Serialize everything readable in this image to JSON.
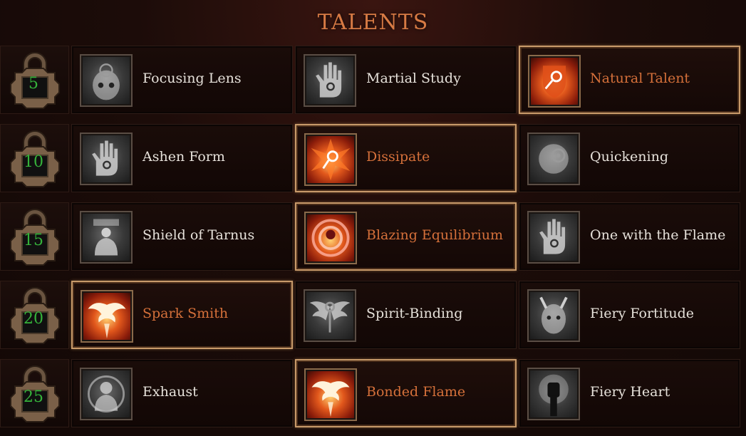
{
  "title": "TALENTS",
  "colors": {
    "selected_text": "#d5703a",
    "normal_text": "#e6e1da",
    "lock_number": "#35b23a",
    "title": "#d77a44",
    "selected_border": "#c89a6a"
  },
  "rows": [
    {
      "level": "5",
      "talents": [
        {
          "name": "Focusing Lens",
          "selected": false,
          "icon": "skull-flame-icon"
        },
        {
          "name": "Martial Study",
          "selected": false,
          "icon": "hand-sigil-icon"
        },
        {
          "name": "Natural Talent",
          "selected": true,
          "icon": "shield-sigil-icon"
        }
      ]
    },
    {
      "level": "10",
      "talents": [
        {
          "name": "Ashen Form",
          "selected": false,
          "icon": "hand-sigil-icon"
        },
        {
          "name": "Dissipate",
          "selected": true,
          "icon": "burst-sigil-icon"
        },
        {
          "name": "Quickening",
          "selected": false,
          "icon": "face-orb-icon"
        }
      ]
    },
    {
      "level": "15",
      "talents": [
        {
          "name": "Shield of Tarnus",
          "selected": false,
          "icon": "figure-icon"
        },
        {
          "name": "Blazing Equilibrium",
          "selected": true,
          "icon": "spiral-icon"
        },
        {
          "name": "One with the Flame",
          "selected": false,
          "icon": "hand-sigil-icon"
        }
      ]
    },
    {
      "level": "20",
      "talents": [
        {
          "name": "Spark Smith",
          "selected": true,
          "icon": "phoenix-icon"
        },
        {
          "name": "Spirit-Binding",
          "selected": false,
          "icon": "winged-sigil-icon"
        },
        {
          "name": "Fiery Fortitude",
          "selected": false,
          "icon": "demon-face-icon"
        }
      ]
    },
    {
      "level": "25",
      "talents": [
        {
          "name": "Exhaust",
          "selected": false,
          "icon": "hooded-figure-icon"
        },
        {
          "name": "Bonded Flame",
          "selected": true,
          "icon": "phoenix-icon"
        },
        {
          "name": "Fiery Heart",
          "selected": false,
          "icon": "raised-fist-icon"
        }
      ]
    }
  ]
}
